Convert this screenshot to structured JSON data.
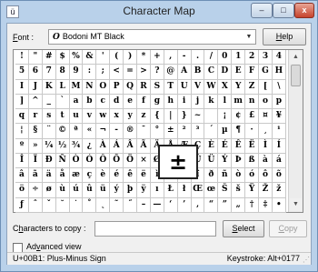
{
  "window": {
    "title": "Character Map",
    "app_icon_glyph": "ü",
    "minimize_glyph": "–",
    "maximize_glyph": "□",
    "close_glyph": "x"
  },
  "font": {
    "label_underlined": "F",
    "label_rest": "ont :",
    "icon_glyph": "O",
    "selected": "Bodoni MT Black",
    "arrow_glyph": "▼"
  },
  "help_button": {
    "underlined": "H",
    "rest": "elp"
  },
  "grid": {
    "cells": [
      "!",
      "\"",
      "#",
      "$",
      "%",
      "&",
      "'",
      "(",
      ")",
      "*",
      "+",
      ",",
      "-",
      ".",
      "/",
      "0",
      "1",
      "2",
      "3",
      "4",
      "5",
      "6",
      "7",
      "8",
      "9",
      ":",
      ";",
      "<",
      "=",
      ">",
      "?",
      "@",
      "A",
      "B",
      "C",
      "D",
      "E",
      "F",
      "G",
      "H",
      "I",
      "J",
      "K",
      "L",
      "M",
      "N",
      "O",
      "P",
      "Q",
      "R",
      "S",
      "T",
      "U",
      "V",
      "W",
      "X",
      "Y",
      "Z",
      "[",
      "\\",
      "]",
      "^",
      "_",
      "`",
      "a",
      "b",
      "c",
      "d",
      "e",
      "f",
      "g",
      "h",
      "i",
      "j",
      "k",
      "l",
      "m",
      "n",
      "o",
      "p",
      "q",
      "r",
      "s",
      "t",
      "u",
      "v",
      "w",
      "x",
      "y",
      "z",
      "{",
      "|",
      "}",
      "~",
      "",
      "¡",
      "¢",
      "£",
      "¤",
      "¥",
      "¦",
      "§",
      "¨",
      "©",
      "ª",
      "«",
      "¬",
      "-",
      "®",
      "¯",
      "°",
      "±",
      "²",
      "³",
      "´",
      "µ",
      "¶",
      "·",
      "¸",
      "¹",
      "º",
      "»",
      "¼",
      "½",
      "¾",
      "¿",
      "À",
      "Á",
      "Â",
      "Ã",
      "Ä",
      "Å",
      "Æ",
      "Ç",
      "È",
      "É",
      "Ê",
      "Ë",
      "Ì",
      "Í",
      "Î",
      "Ï",
      "Ð",
      "Ñ",
      "Ò",
      "Ó",
      "Ô",
      "Õ",
      "Ö",
      "×",
      "Ø",
      "Ù",
      "Ú",
      "Û",
      "Ü",
      "Ý",
      "Þ",
      "ß",
      "à",
      "á",
      "â",
      "ã",
      "ä",
      "å",
      "æ",
      "ç",
      "è",
      "é",
      "ê",
      "ë",
      "ì",
      "í",
      "î",
      "ï",
      "ð",
      "ñ",
      "ò",
      "ó",
      "ô",
      "õ",
      "ö",
      "÷",
      "ø",
      "ù",
      "ú",
      "û",
      "ü",
      "ý",
      "þ",
      "ÿ",
      "ı",
      "Ł",
      "ł",
      "Œ",
      "œ",
      "Š",
      "š",
      "Ÿ",
      "Ž",
      "ž",
      "ƒ",
      "ˆ",
      "ˇ",
      "˘",
      "˙",
      "˚",
      "˛",
      "˜",
      "˝",
      "–",
      "—",
      "‘",
      "’",
      "‚",
      "“",
      "”",
      "„",
      "†",
      "‡",
      "•"
    ],
    "magnified": "±"
  },
  "scrollbar": {
    "up_glyph": "▲",
    "down_glyph": "▼"
  },
  "copy": {
    "label_pre": "C",
    "label_underlined": "h",
    "label_rest": "aracters to copy :",
    "value": "",
    "select_underlined": "S",
    "select_rest": "elect",
    "copy_underlined": "C",
    "copy_rest": "opy"
  },
  "advanced": {
    "checked": false,
    "label_pre": "Ad",
    "label_underlined": "v",
    "label_rest": "anced view"
  },
  "status": {
    "character": "U+00B1: Plus-Minus Sign",
    "keystroke": "Keystroke: Alt+0177",
    "grip_glyph": "⋰"
  }
}
